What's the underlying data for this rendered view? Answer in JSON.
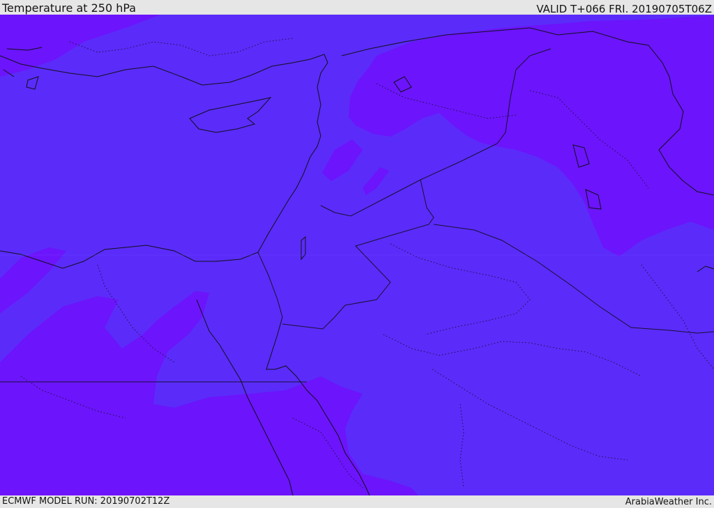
{
  "header": {
    "title": "Temperature at 250 hPa",
    "valid": "VALID T+066 FRI. 20190705T06Z"
  },
  "footer": {
    "model_run": "ECMWF MODEL RUN: 20190702T12Z",
    "credit": "ArabiaWeather Inc."
  },
  "colors": {
    "frame": "#e6e6e6",
    "temp_band_warmer": "#5b2bfa",
    "temp_band_colder": "#6c14fc",
    "coastline": "#101018",
    "border": "#181030"
  },
  "map": {
    "field": "Temperature at 250 hPa",
    "region": "Eastern Mediterranean, Levant, Egypt, Arabian Peninsula, Iraq"
  }
}
